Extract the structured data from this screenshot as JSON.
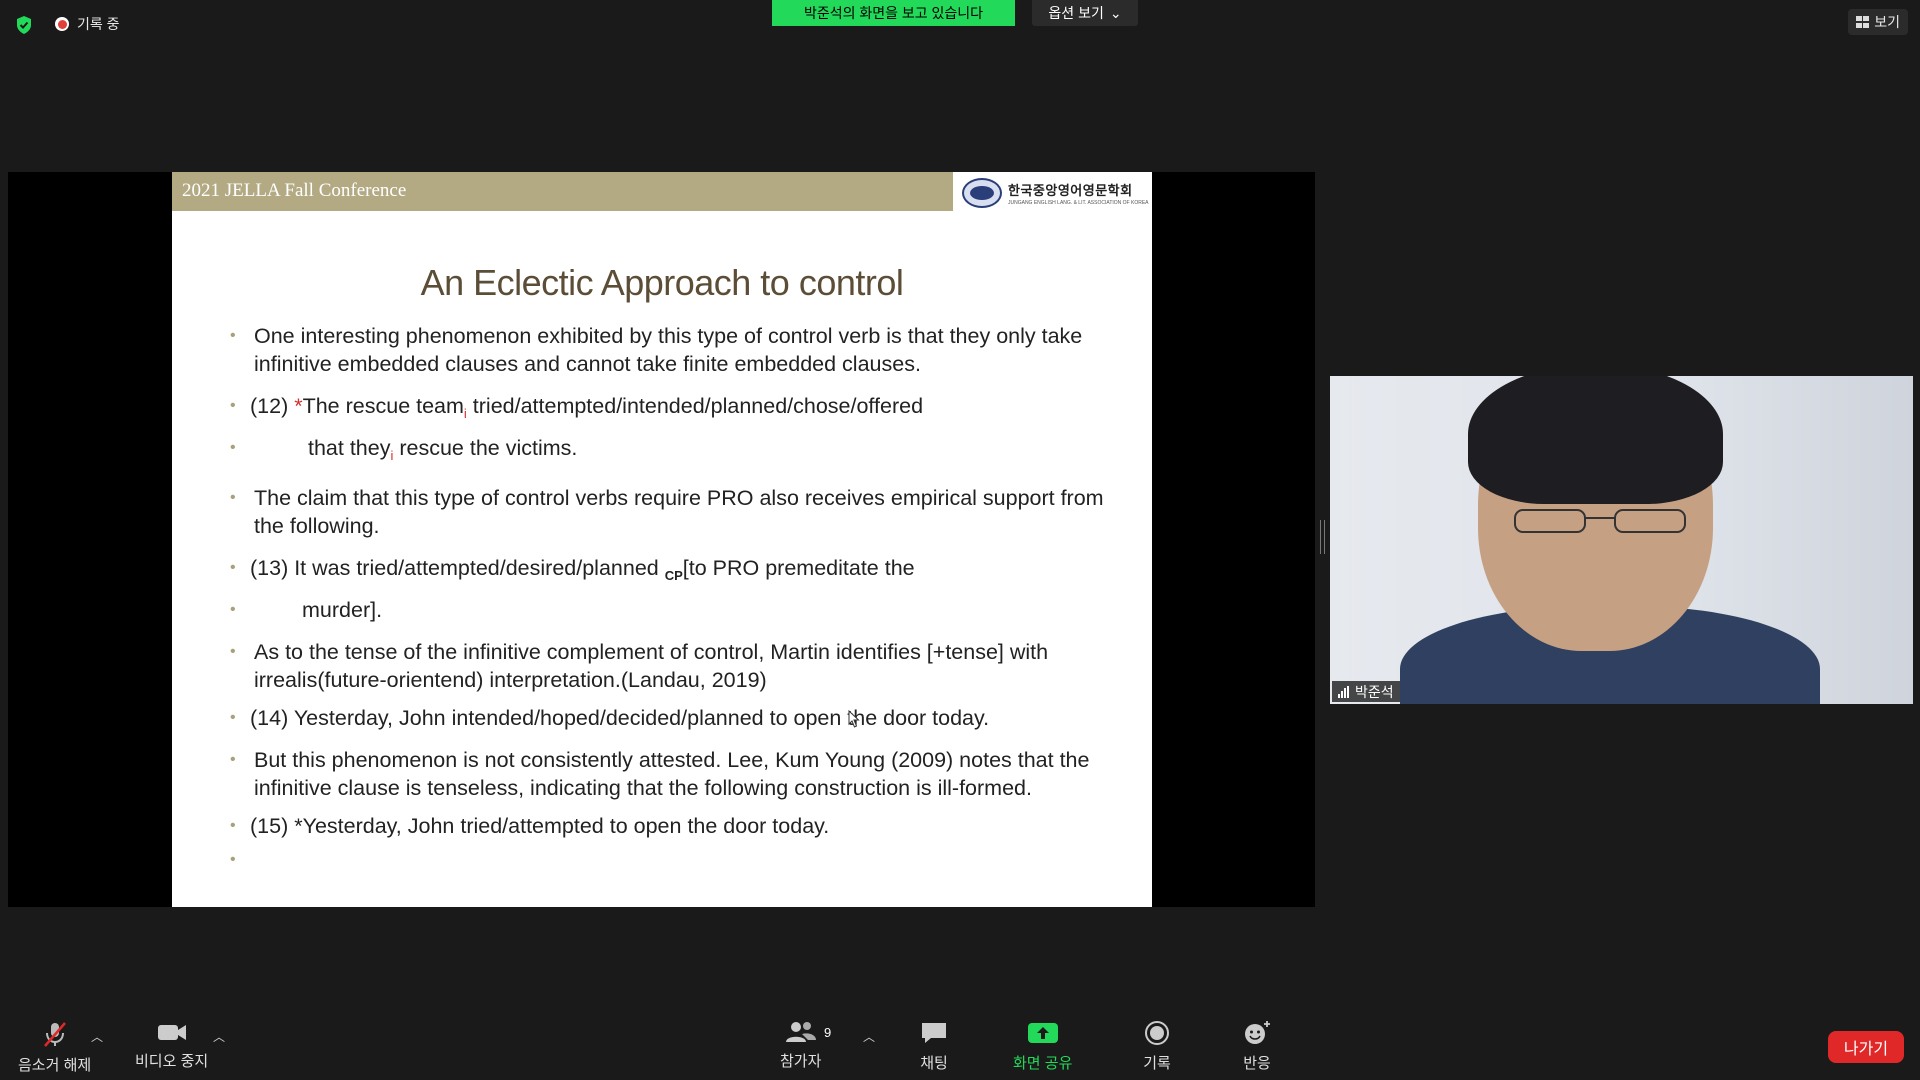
{
  "top": {
    "recording_label": "기록 중",
    "viewing_banner": "박준석의 화면을 보고 있습니다",
    "view_options": "옵션 보기",
    "view_button": "보기"
  },
  "slide": {
    "banner": "2021 JELLA Fall Conference",
    "logo_name": "한국중앙영어영문학회",
    "logo_sub": "JUNGANG ENGLISH LANG. & LIT. ASSOCIATION OF KOREA",
    "title": "An Eclectic Approach to control",
    "b1": "One interesting phenomenon exhibited by this type of control verb is that they only take infinitive embedded clauses and cannot take finite embedded clauses.",
    "b2_num": "(12) ",
    "b2_star": "*",
    "b2_a": "The rescue team",
    "b2_i": "i",
    "b2_b": " tried/attempted/intended/planned/chose/offered",
    "b3_a": "that they",
    "b3_i": "i",
    "b3_b": " rescue the victims.",
    "b4": "The claim that this type of control verbs require PRO also receives empirical support from the following.",
    "b5_a": "(13) It was tried/attempted/desired/planned ",
    "b5_sub": "CP",
    "b5_b": "[to PRO premeditate the",
    "b6": "murder].",
    "b7": "As to the tense of the infinitive complement of control, Martin identifies [+tense] with irrealis(future-orientend) interpretation.(Landau, 2019)",
    "b8": "(14) Yesterday, John intended/hoped/decided/planned to open the door today.",
    "b9": "But this phenomenon is not consistently attested. Lee, Kum Young (2009) notes that the infinitive clause is tenseless, indicating that the following construction is ill-formed.",
    "b10": "(15) *Yesterday, John tried/attempted to open the door today."
  },
  "participant": {
    "name": "박준석"
  },
  "toolbar": {
    "mute": "음소거 해제",
    "video": "비디오 중지",
    "participants": "참가자",
    "participant_count": "9",
    "chat": "채팅",
    "share": "화면 공유",
    "record": "기록",
    "reactions": "반응",
    "leave": "나가기"
  },
  "colors": {
    "share_green": "#23d959",
    "leave_red": "#e02828",
    "banner_tan": "#b3aa84"
  }
}
